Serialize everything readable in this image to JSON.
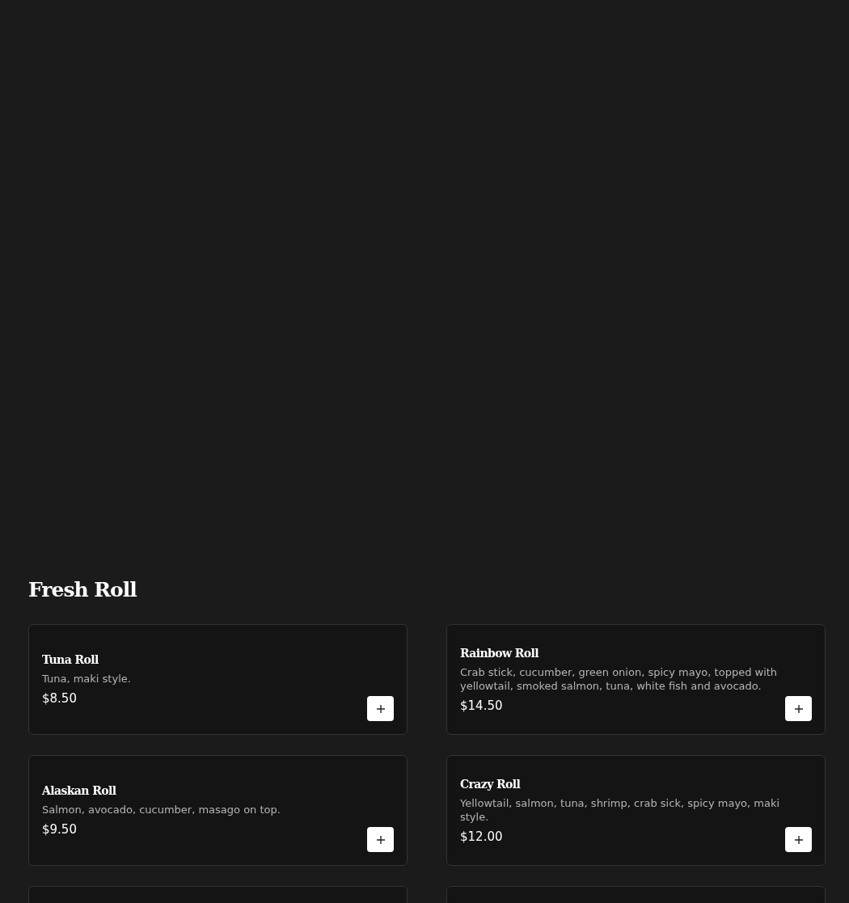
{
  "section": {
    "title": "Fresh Roll"
  },
  "items": [
    {
      "kind": "dish",
      "name": "Tuna Roll",
      "description": "Tuna, maki style.",
      "price": "$8.50"
    },
    {
      "kind": "dish",
      "name": "Rainbow Roll",
      "description": "Crab stick, cucumber, green onion, spicy mayo, topped with yellowtail, smoked salmon, tuna, white fish and avocado.",
      "price": "$14.50"
    },
    {
      "kind": "dish",
      "name": "Alaskan Roll",
      "description": "Salmon, avocado, cucumber, masago on top.",
      "price": "$9.50"
    },
    {
      "kind": "dish",
      "name": "Crazy Roll",
      "description": "Yellowtail, salmon, tuna, shrimp, crab sick, spicy mayo, maki style.",
      "price": "$12.00"
    },
    {
      "kind": "cut"
    },
    {
      "kind": "cut"
    }
  ]
}
